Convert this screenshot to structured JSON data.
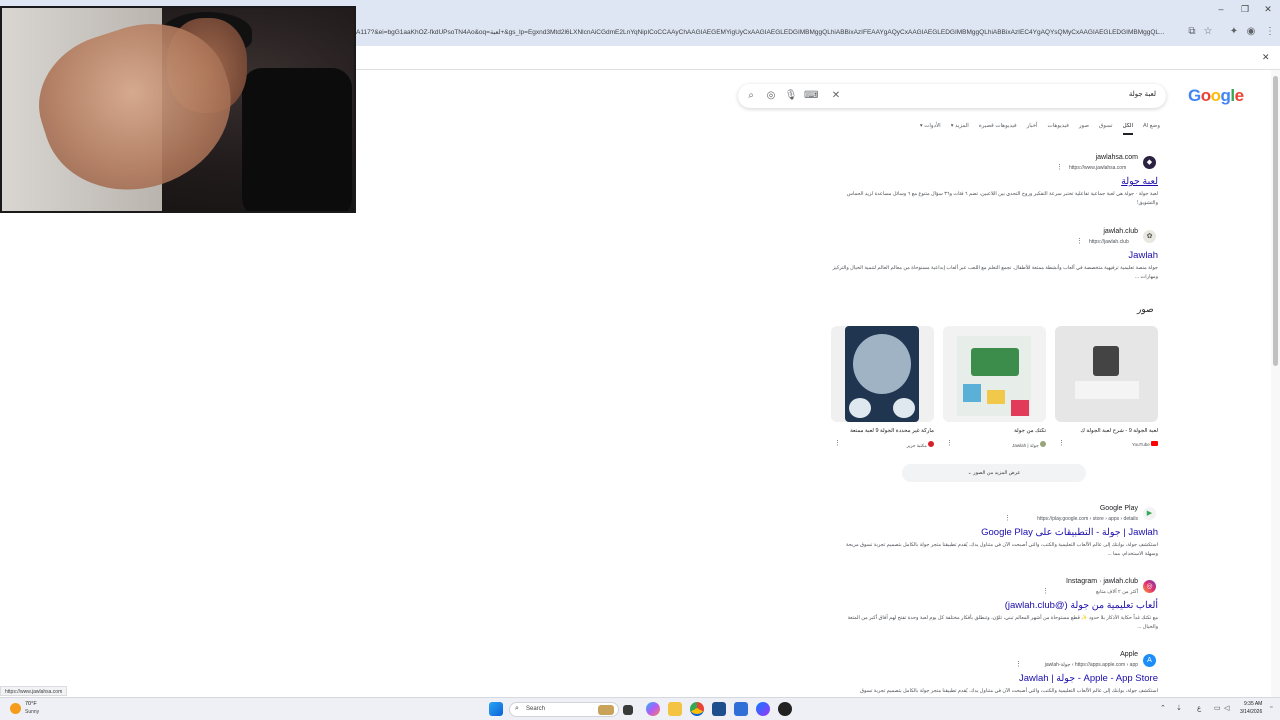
{
  "browser": {
    "url": "A117?&ei=bgG1aaKhOZ-fkdUPsoTN4Ao&oq=لعبة+&gs_lp=Egxnd3Mtd2l6LXNlcnAiCGdmE2LnYqNipICoCCAAyChAAGIAEGEMYigUyCxAAGIAEGLEDGIMBMggQLhiABBixAzIFEAAYgAQyCxAAGIAEGLEDGIMBMggQLhiABBixAzIEC4YgAQYsQMyCxAAGIAEGLEDGIMBMggQL...",
    "status_url": "https://www.jawlahsa.com"
  },
  "search": {
    "query": "لعبة جولة",
    "tabs": [
      "وضع AI",
      "الكل",
      "تسوق",
      "صور",
      "فيديوهات",
      "أخبار",
      "فيديوهات قصيرة",
      "المزيد ▾",
      "الأدوات ▾"
    ]
  },
  "results": {
    "r1": {
      "site": "jawlahsa.com",
      "url": "https://www.jawlahsa.com",
      "title": "لعبة جولة",
      "snippet": "لعبة جولة · جولة هي لعبة جماعية تفاعلية تختبر سرعة التفكير وروح التحدي بين اللاعبين، تضم ٦ فئات و٣٦ سؤال متنوع مع ٦ وسائل مساعدة لزيد الحماس والتشويق!"
    },
    "r2": {
      "site": "jawlah.club",
      "url": "https://jawlah.club",
      "title": "Jawlah",
      "snippet": "جولة منصة تعليمية ترفيهية متخصصة في ألعاب وأنشطة ممتعة للأطفال. تجمع التعلم مع اللعب عبر ألعاب إبداعية مستوحاة من معالم العالم لتنمية الخيال والتركيز ومهارات ..."
    },
    "images": {
      "heading": "صور",
      "items": [
        {
          "caption": "لعبة الجولة 9 - شرح لعبة الجولة ك",
          "source": "YouTube"
        },
        {
          "caption": "تكتك من جولة",
          "source": "جولة | Jawlah"
        },
        {
          "caption": "ماركة غير محددة الجولة 9 لعبة ممتعة",
          "source": "مكتبة جرير"
        }
      ],
      "more": "عرض المزيد من الصور ⌄"
    },
    "r3": {
      "site": "Google Play",
      "url": "https://play.google.com › store › apps › details",
      "title": "Jawlah | جولة - التطبيقات على Google Play",
      "snippet": "استكشف جولة، بوابتك إلى عالم الألعاب التعليمية والكتب، والتي أصبحت الآن في متناول يدك. يُقدم تطبيقنا متجر جولة بالكامل بتصميم تجربة تسوق مريحة وسهلة الاستخدام، مما ..."
    },
    "r4": {
      "site": "Instagram · jawlah.club",
      "url": "أكثر من ٢ آلاف متابع",
      "title": "ألعاب تعليمية من جولة (@jawlah.club)",
      "snippet": "مع تكتك غداً حكاية الأذكار بلا حدود ✨ قطع مستوحاة من أشهر المعالم تبني، تلوّن، وتنطلق بأفكار مختلفة كل يوم لعبة وحدة تفتح لهم آفاق أكبر من المتعة والخيال ..."
    },
    "r5": {
      "site": "Apple",
      "url": "https://apps.apple.com › app › جولة-jawlah",
      "title": "Apple - App Store - جولة | Jawlah",
      "snippet": "استكشف جولة، بوابتك إلى عالم الألعاب التعليمية والكتب، والتي أصبحت الآن في متناول يدك. يُقدم تطبيقنا متجر جولة بالكامل بتصميم تجربة تسوق"
    }
  },
  "taskbar": {
    "weather_temp": "70°F",
    "weather_desc": "Sunny",
    "search_placeholder": "Search",
    "time": "9:35 AM",
    "date": "3/14/2026"
  },
  "colors": {
    "link": "#1a0dab",
    "chrome_bar": "#dfe6f3",
    "taskbar": "#eef0f5"
  }
}
